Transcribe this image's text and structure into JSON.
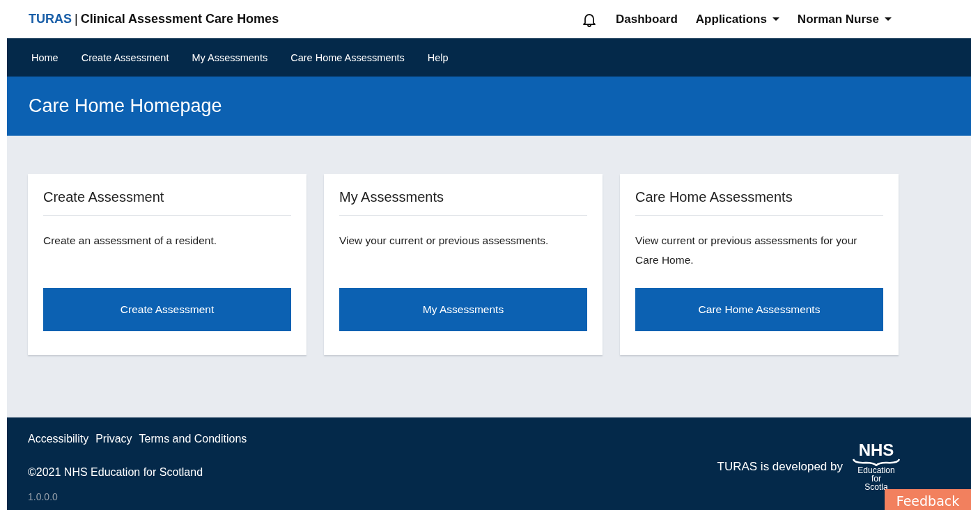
{
  "header": {
    "brand": "TURAS",
    "separator": "|",
    "app_title": "Clinical Assessment Care Homes",
    "links": [
      {
        "label": "Dashboard",
        "dropdown": false
      },
      {
        "label": "Applications",
        "dropdown": true
      },
      {
        "label": "Norman Nurse",
        "dropdown": true
      }
    ]
  },
  "nav": [
    {
      "label": "Home"
    },
    {
      "label": "Create Assessment"
    },
    {
      "label": "My Assessments"
    },
    {
      "label": "Care Home Assessments"
    },
    {
      "label": "Help"
    }
  ],
  "banner": {
    "title": "Care Home Homepage"
  },
  "cards": [
    {
      "title": "Create Assessment",
      "text": "Create an assessment of a resident.",
      "button": "Create Assessment"
    },
    {
      "title": "My Assessments",
      "text": "View your current or previous assessments.",
      "button": "My Assessments"
    },
    {
      "title": "Care Home Assessments",
      "text": "View current or previous assessments for your Care Home.",
      "button": "Care Home Assessments"
    }
  ],
  "footer": {
    "links": [
      "Accessibility",
      "Privacy",
      "Terms and Conditions"
    ],
    "copyright": "©2021 NHS Education for Scotland",
    "version": "1.0.0.0",
    "developed_by": "TURAS is developed by",
    "logo": {
      "mark": "NHS",
      "lines": [
        "Education",
        "for",
        "Scotla"
      ]
    }
  },
  "feedback": "Feedback"
}
